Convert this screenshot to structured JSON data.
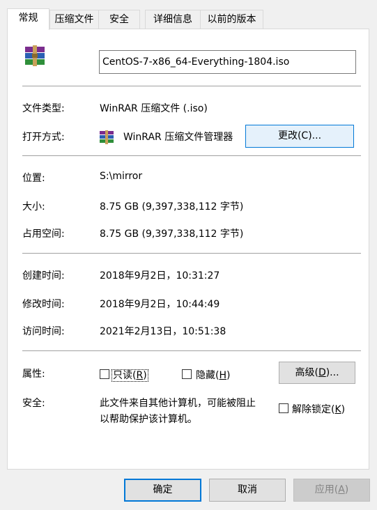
{
  "tabs": [
    {
      "label": "常规",
      "active": true
    },
    {
      "label": "压缩文件"
    },
    {
      "label": "安全"
    },
    {
      "label": "详细信息"
    },
    {
      "label": "以前的版本"
    }
  ],
  "file": {
    "name": "CentOS-7-x86_64-Everything-1804.iso",
    "icon": "winrar-archive-icon"
  },
  "fields": {
    "type_label": "文件类型:",
    "type_value": "WinRAR 压缩文件 (.iso)",
    "open_label": "打开方式:",
    "open_value": "WinRAR 压缩文件管理器",
    "change_button": "更改(C)...",
    "location_label": "位置:",
    "location_value": "S:\\mirror",
    "size_label": "大小:",
    "size_value": "8.75 GB (9,397,338,112 字节)",
    "disk_label": "占用空间:",
    "disk_value": "8.75 GB (9,397,338,112 字节)",
    "created_label": "创建时间:",
    "created_value": "2018年9月2日，10:31:27",
    "modified_label": "修改时间:",
    "modified_value": "2018年9月2日，10:44:49",
    "accessed_label": "访问时间:",
    "accessed_value": "2021年2月13日，10:51:38",
    "attributes_label": "属性:",
    "readonly_text": "只读(",
    "readonly_key": "R",
    "readonly_close": ")",
    "hidden_text": "隐藏(",
    "hidden_key": "H",
    "hidden_close": ")",
    "advanced_text": "高级(",
    "advanced_key": "D",
    "advanced_close": ")...",
    "security_label": "安全:",
    "security_line1": "此文件来自其他计算机，可能被阻止",
    "security_line2": "以帮助保护该计算机。",
    "unblock_text": "解除锁定(",
    "unblock_key": "K",
    "unblock_close": ")"
  },
  "buttons": {
    "ok": "确定",
    "cancel": "取消",
    "apply_text": "应用(",
    "apply_key": "A",
    "apply_close": ")"
  },
  "colors": {
    "focus_blue": "#0078d7",
    "separator": "#a0a0a0",
    "disabled_text": "#838383"
  }
}
